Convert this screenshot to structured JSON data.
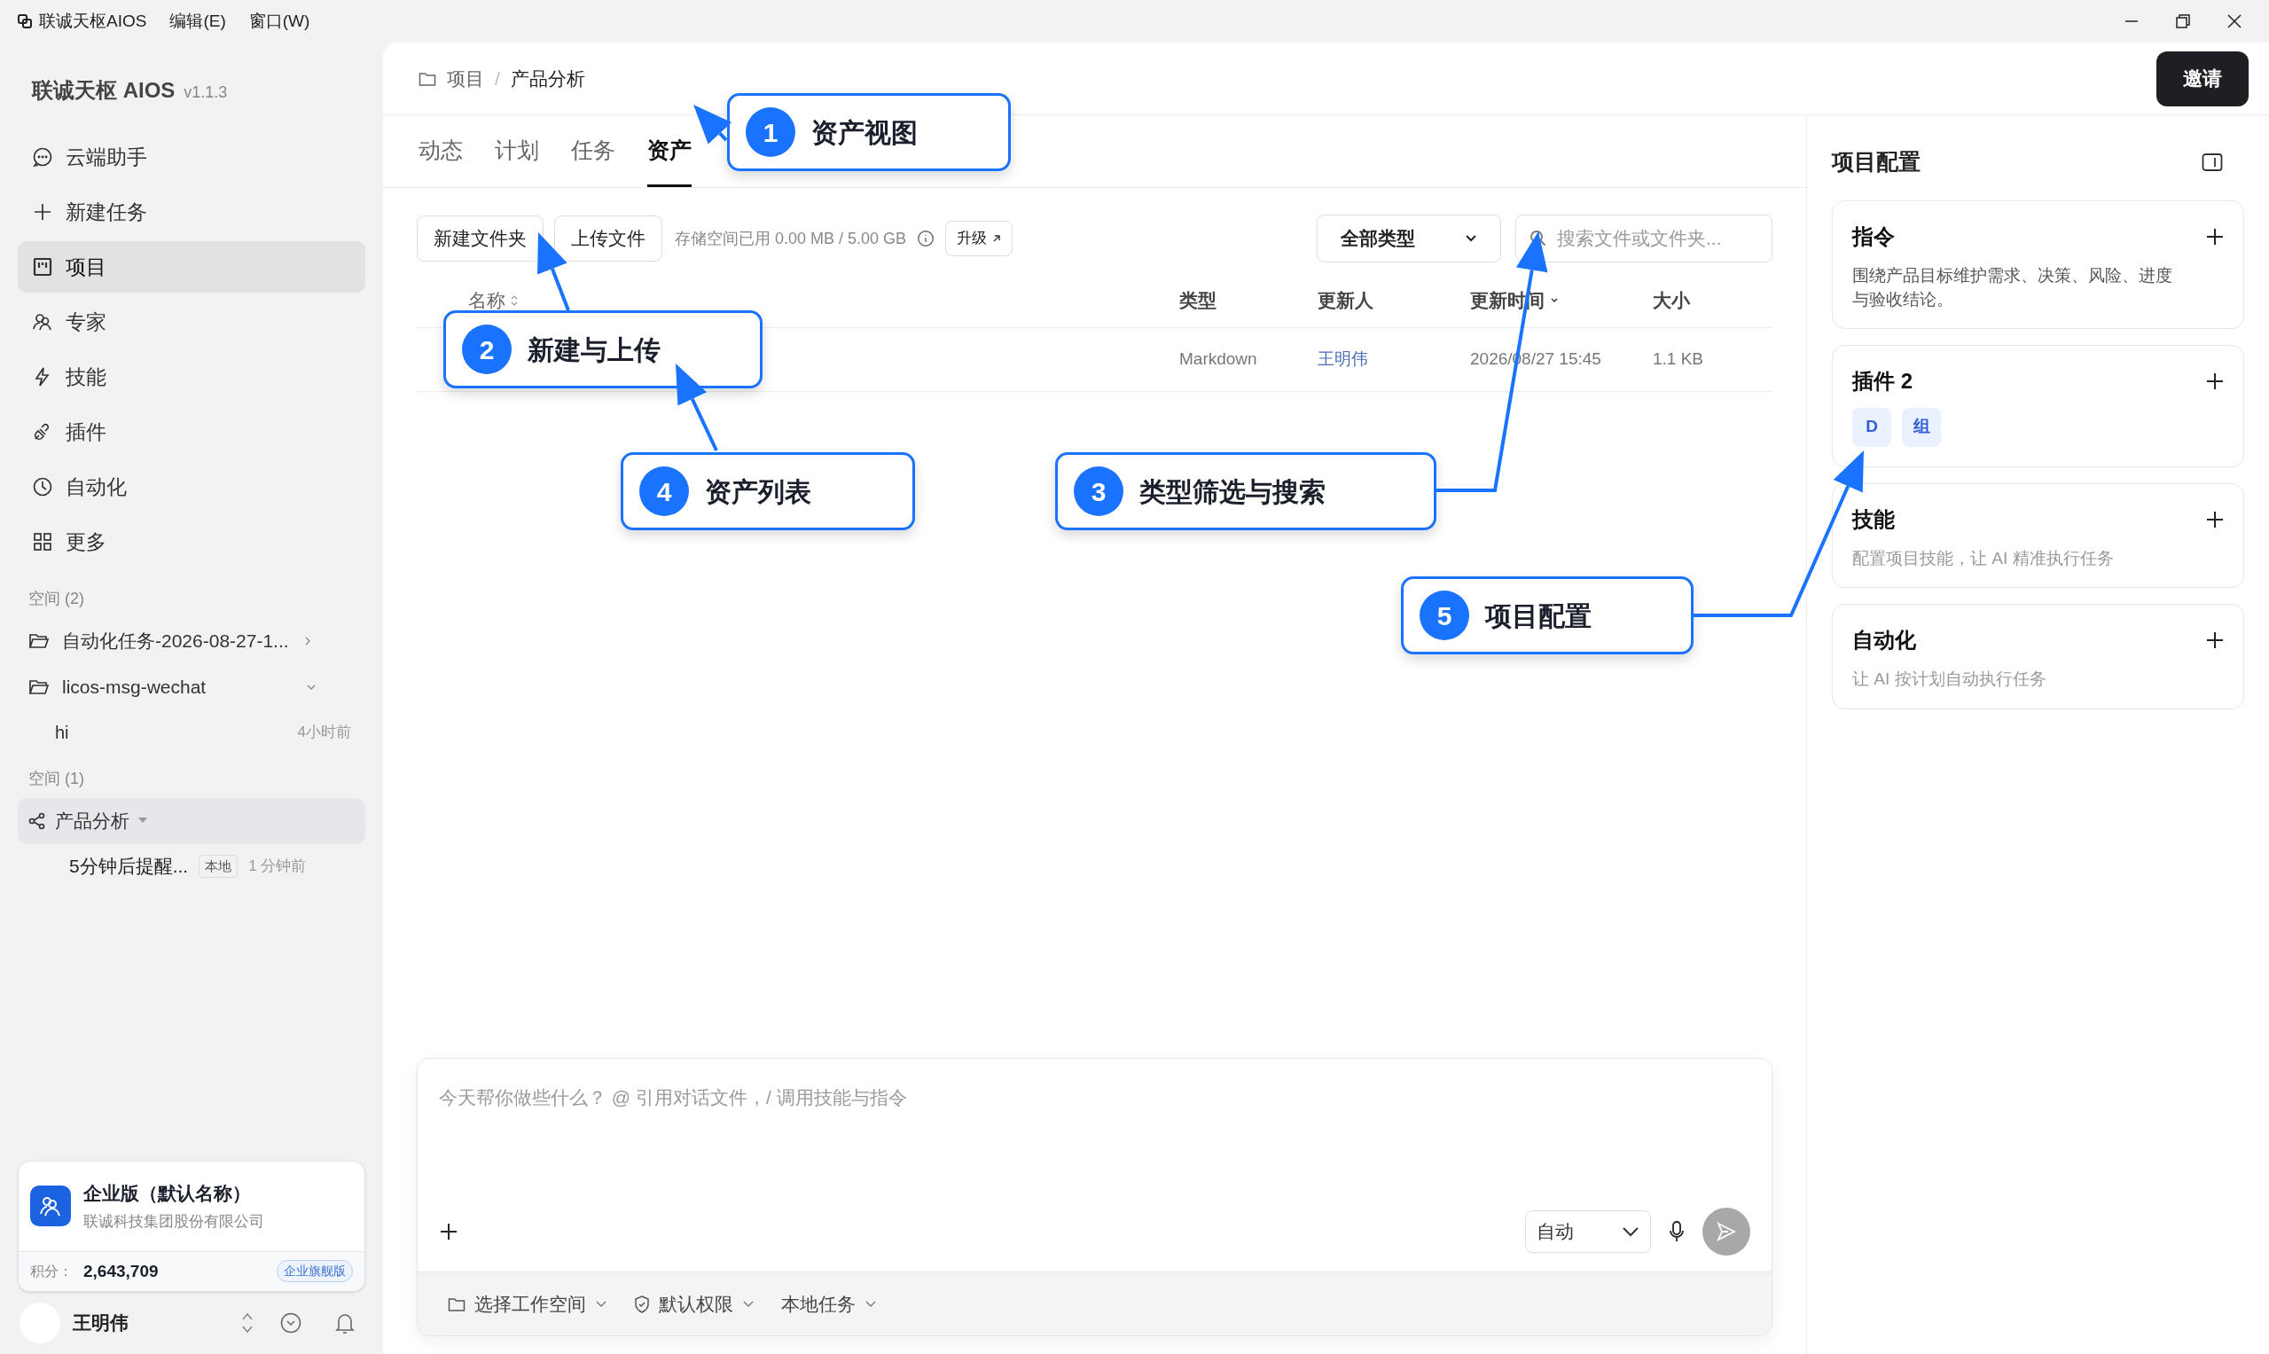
{
  "menu_bar": {
    "app": "联诚天枢AIOS",
    "menus": [
      "编辑(E)",
      "窗口(W)"
    ]
  },
  "sidebar": {
    "brand": "联诚天枢 AIOS",
    "version": "v1.1.3",
    "nav": [
      {
        "label": "云端助手",
        "selected": false
      },
      {
        "label": "新建任务",
        "selected": false
      },
      {
        "label": "项目",
        "selected": true
      },
      {
        "label": "专家",
        "selected": false
      },
      {
        "label": "技能",
        "selected": false
      },
      {
        "label": "插件",
        "selected": false
      },
      {
        "label": "自动化",
        "selected": false
      },
      {
        "label": "更多",
        "selected": false
      }
    ],
    "spaces": [
      {
        "heading": "空间 (2)",
        "items": [
          {
            "kind": "folder",
            "label": "自动化任务-2026-08-27-1...",
            "expanded": false
          },
          {
            "kind": "folder",
            "label": "licos-msg-wechat",
            "expanded": true,
            "children": [
              {
                "label": "hi",
                "time": "4小时前"
              }
            ]
          }
        ]
      },
      {
        "heading": "空间 (1)",
        "items": [
          {
            "kind": "project",
            "label": "产品分析",
            "selected": true,
            "children": [
              {
                "label": "5分钟后提醒...",
                "tag": "本地",
                "time": "1 分钟前"
              }
            ]
          }
        ]
      }
    ],
    "account": {
      "plan": "企业版（默认名称）",
      "company": "联诚科技集团股份有限公司",
      "points_label": "积分：",
      "points": "2,643,709",
      "badge": "企业旗舰版"
    },
    "user": {
      "name": "王明伟"
    }
  },
  "header": {
    "breadcrumb": [
      "项目",
      "产品分析"
    ],
    "breadcrumb_separator": "/",
    "invite": "邀请"
  },
  "tabs": [
    {
      "label": "动态",
      "selected": false
    },
    {
      "label": "计划",
      "selected": false
    },
    {
      "label": "任务",
      "selected": false
    },
    {
      "label": "资产",
      "selected": true
    }
  ],
  "toolbar": {
    "new_folder": "新建文件夹",
    "upload": "上传文件",
    "storage": "存储空间已用 0.00 MB / 5.00 GB",
    "upgrade": "升级",
    "type_filter": "全部类型",
    "search": {
      "placeholder": "搜索文件或文件夹..."
    }
  },
  "table": {
    "columns": [
      "名称",
      "类型",
      "更新人",
      "更新时间",
      "大小"
    ],
    "rows": [
      {
        "type": "Markdown",
        "updated_by": "王明伟",
        "updated_at": "2026/08/27 15:45",
        "size": "1.1 KB"
      }
    ]
  },
  "composer": {
    "placeholder": "今天帮你做些什么？ @ 引用对话文件，/ 调用技能与指令",
    "mode": "自动",
    "footer": [
      "选择工作空间",
      "默认权限",
      "本地任务"
    ]
  },
  "project_config": {
    "title": "项目配置",
    "cards": [
      {
        "kind": "text",
        "title": "指令",
        "description": "围绕产品目标维护需求、决策、风险、进度与验收结论。"
      },
      {
        "kind": "chips",
        "title": "插件 2",
        "chips": [
          "D",
          "组"
        ]
      },
      {
        "kind": "hint",
        "title": "技能",
        "description": "配置项目技能，让 AI 精准执行任务"
      },
      {
        "kind": "hint",
        "title": "自动化",
        "description": "让 AI 按计划自动执行任务"
      }
    ]
  },
  "callouts": [
    {
      "number": "1",
      "label": "资产视图"
    },
    {
      "number": "2",
      "label": "新建与上传"
    },
    {
      "number": "4",
      "label": "资产列表"
    },
    {
      "number": "3",
      "label": "类型筛选与搜索"
    },
    {
      "number": "5",
      "label": "项目配置"
    }
  ]
}
